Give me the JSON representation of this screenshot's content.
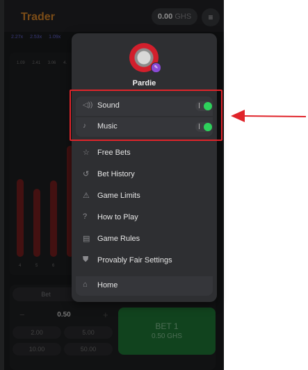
{
  "header": {
    "app_title": "Trader",
    "balance_value": "0.00",
    "balance_currency": "GHS",
    "menu_icon": "hamburger-icon"
  },
  "multipliers": [
    "2.27x",
    "2.53x",
    "1.09x"
  ],
  "row_labels": [
    "1.09",
    "2.41",
    "3.06",
    "4."
  ],
  "bars": [
    {
      "label": "4"
    },
    {
      "label": "5"
    },
    {
      "label": "6"
    }
  ],
  "bet_panel": {
    "tab_label": "Bet",
    "amount": "0.50",
    "quick_amounts": [
      "2.00",
      "5.00",
      "10.00",
      "50.00"
    ],
    "bet_button_line1": "BET 1",
    "bet_button_line2": "0.50 GHS"
  },
  "user_menu": {
    "username": "Pardie",
    "toggles": [
      {
        "label": "Sound",
        "icon": "speaker-icon",
        "on": true
      },
      {
        "label": "Music",
        "icon": "music-note-icon",
        "on": true
      }
    ],
    "items": [
      {
        "label": "Free Bets",
        "icon": "star-icon"
      },
      {
        "label": "Bet History",
        "icon": "history-icon"
      },
      {
        "label": "Game Limits",
        "icon": "warning-icon"
      },
      {
        "label": "How to Play",
        "icon": "question-icon"
      },
      {
        "label": "Game Rules",
        "icon": "document-icon"
      },
      {
        "label": "Provably Fair Settings",
        "icon": "shield-icon"
      }
    ],
    "home": {
      "label": "Home",
      "icon": "home-icon"
    }
  },
  "colors": {
    "accent_orange": "#e08a2a",
    "toggle_on": "#2ed15b",
    "bet_green": "#1f7a38",
    "highlight_red": "#e0242a"
  }
}
